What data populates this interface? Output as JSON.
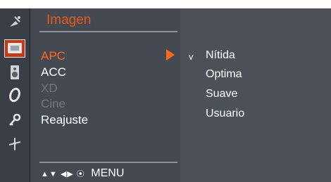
{
  "menu": {
    "title": "Imagen",
    "items": [
      {
        "label": "APC",
        "state": "active"
      },
      {
        "label": "ACC",
        "state": "normal"
      },
      {
        "label": "XD",
        "state": "disabled"
      },
      {
        "label": "Cine",
        "state": "disabled"
      },
      {
        "label": "Reajuste",
        "state": "normal"
      }
    ]
  },
  "submenu": {
    "check_mark": "v",
    "options": [
      "Nítida",
      "Optima",
      "Suave",
      "Usuario"
    ],
    "selected": "Nítida"
  },
  "icons": [
    "satellite-icon",
    "picture-icon",
    "speaker-icon",
    "clock-icon",
    "key-icon",
    "settings-icon"
  ],
  "footer": {
    "nav_symbols": "▲▼ ◀▶ ⦿",
    "menu_label": "MENU"
  },
  "colors": {
    "accent": "#ff6a1a",
    "title": "#e55a1c",
    "selected_icon_bg": "#c23a18",
    "panel": "#454a52",
    "disabled": "#72767d"
  }
}
